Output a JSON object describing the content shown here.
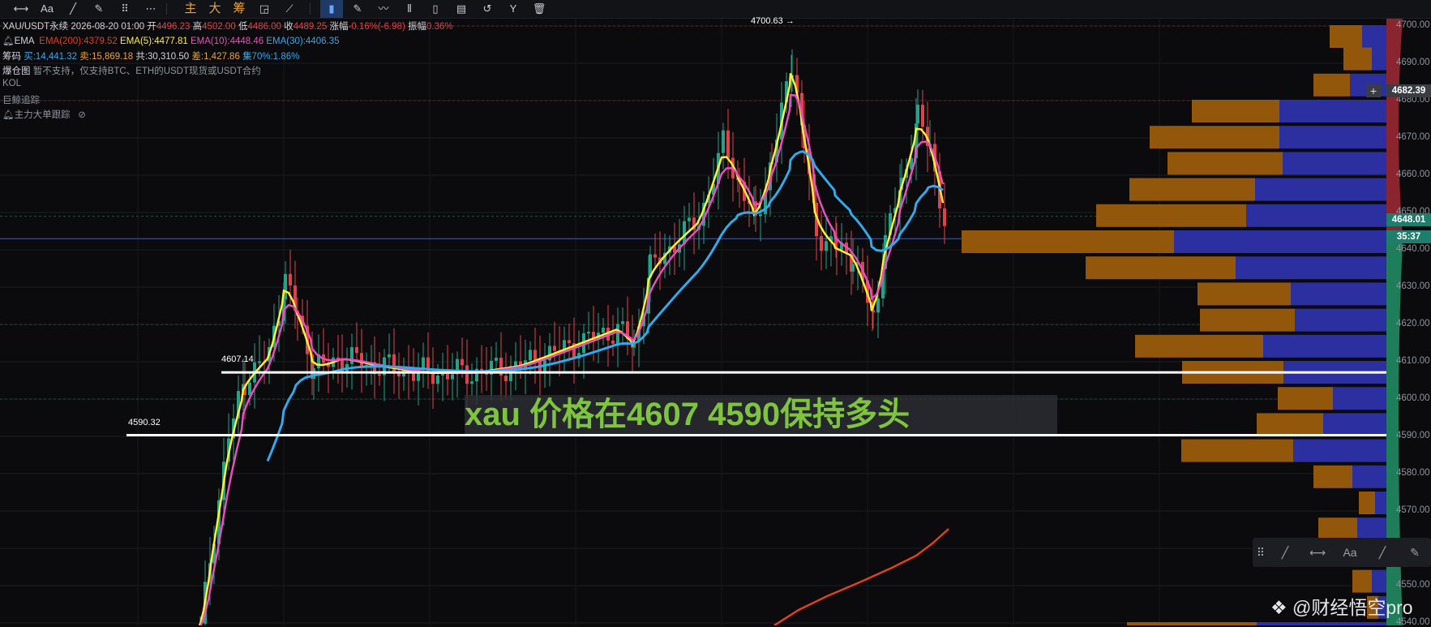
{
  "toolbar": {
    "items": [
      "⟷",
      "Aa",
      "╱",
      "✎",
      "⠿",
      "⋯",
      "主",
      "大",
      "筹",
      "◲",
      "⟋",
      "▮",
      "✎",
      "〰",
      "⦀",
      "▯",
      "▤",
      "↺",
      "Y",
      "🗑"
    ],
    "active_index": 11
  },
  "info": {
    "symbol": "XAU/USDT永续",
    "time": "2026-08-20 01:00",
    "open_label": "开",
    "open": "4496.23",
    "high_label": "高",
    "high": "4502.00",
    "low_label": "低",
    "low": "4486.00",
    "close_label": "收",
    "close": "4489.25",
    "change_label": "涨幅",
    "change": "-0.16%(-6.98)",
    "amp_label": "振幅",
    "amp": "0.36%",
    "ema_title": "EMA",
    "ema200": "EMA(200):4379.52",
    "ema5": "EMA(5):4477.81",
    "ema10": "EMA(10):4448.46",
    "ema30": "EMA(30):4406.35",
    "chips_label": "筹码",
    "buy": "买:14,441.32",
    "sell": "卖:15,869.18",
    "total": "共:30,310.50",
    "diff": "差:1,427.86",
    "concentration": "集70%:1.86%",
    "explode_title": "爆仓图",
    "explode_note": "暂不支持，仅支持BTC、ETH的USDT现货或USDT合约",
    "kol": "KOL",
    "whale": "巨鲸追踪",
    "main_order": "主力大单跟踪"
  },
  "annotations": {
    "peak_label": "4700.63 →",
    "line1_label": "4607.14",
    "line2_label": "4590.32",
    "note": "xau 价格在4607  4590保持多头"
  },
  "price_axis": {
    "labels": [
      "4700.00",
      "4690.00",
      "4680.00",
      "4670.00",
      "4660.00",
      "4650.00",
      "4640.00",
      "4630.00",
      "4620.00",
      "4610.00",
      "4600.00",
      "4590.00",
      "4580.00",
      "4570.00",
      "4560.00",
      "4550.00",
      "4540.00"
    ],
    "tag_top": "4682.39",
    "tag_current": "4648.01",
    "countdown": "35:37"
  },
  "draw_tools": [
    "⠿",
    "╱",
    "⟷",
    "Aa",
    "╱",
    "✎"
  ],
  "watermark": "财经悟空pro",
  "colors": {
    "up": "#22a38a",
    "down": "#e0414a",
    "ema5": "#ffee33",
    "ema10": "#e84fbc",
    "ema30": "#31a9ea",
    "ema200": "#e0401c",
    "vp_orange": "#93570c",
    "vp_blue": "#2b2fa0"
  }
}
